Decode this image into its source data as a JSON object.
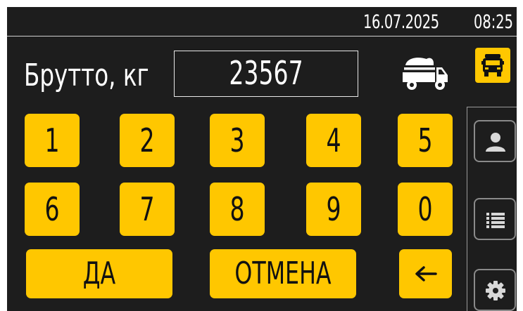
{
  "status": {
    "date": "16.07.2025",
    "time": "08:25"
  },
  "field": {
    "label": "Брутто, кг",
    "value": "23567"
  },
  "keypad": {
    "digits": [
      "1",
      "2",
      "3",
      "4",
      "5",
      "6",
      "7",
      "8",
      "9",
      "0"
    ],
    "confirm_label": "ДА",
    "cancel_label": "ОТМЕНА",
    "backspace_icon": "arrow-left-icon"
  },
  "icons": {
    "loaded_truck": "loaded-truck-icon",
    "vehicle_button": "truck-front-icon",
    "sidebar": [
      "user-icon",
      "list-icon",
      "gear-icon"
    ]
  },
  "colors": {
    "background": "#1d1d1d",
    "accent": "#ffc700",
    "text": "#ffffff",
    "key_text": "#111111",
    "border": "#8a8a8a"
  }
}
